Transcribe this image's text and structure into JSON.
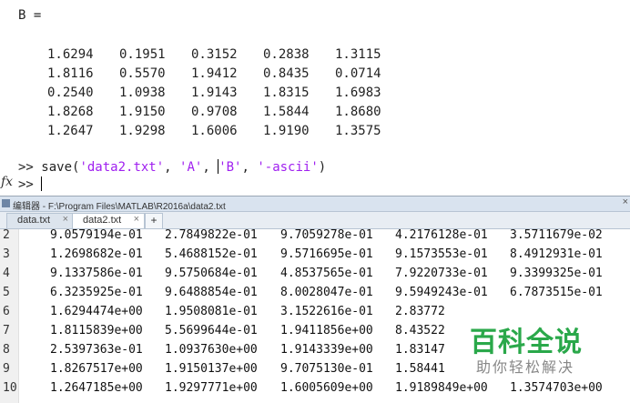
{
  "command_window": {
    "var_assign": "B =",
    "matrix": [
      [
        "1.6294",
        "0.1951",
        "0.3152",
        "0.2838",
        "1.3115"
      ],
      [
        "1.8116",
        "0.5570",
        "1.9412",
        "0.8435",
        "0.0714"
      ],
      [
        "0.2540",
        "1.0938",
        "1.9143",
        "1.8315",
        "1.6983"
      ],
      [
        "1.8268",
        "1.9150",
        "0.9708",
        "1.5844",
        "1.8680"
      ],
      [
        "1.2647",
        "1.9298",
        "1.6006",
        "1.9190",
        "1.3575"
      ]
    ],
    "prompt": ">>",
    "command_prefix": "save(",
    "arg1": "'data2.txt'",
    "sep1": ", ",
    "arg2": "'A'",
    "sep2": ", ",
    "arg3": "'B'",
    "sep3": ", ",
    "arg4": "'-ascii'",
    "command_suffix": ")",
    "fx_label": "fx"
  },
  "editor": {
    "title": "编辑器 - F:\\Program Files\\MATLAB\\R2016a\\data2.txt",
    "close_glyph": "×",
    "tabs": [
      {
        "label": "data.txt",
        "close": "×",
        "active": false
      },
      {
        "label": "data2.txt",
        "close": "×",
        "active": true
      }
    ],
    "add_tab": "+",
    "rows": [
      {
        "line": "2",
        "values": [
          "9.0579194e-01",
          "2.7849822e-01",
          "9.7059278e-01",
          "4.2176128e-01",
          "3.5711679e-02"
        ]
      },
      {
        "line": "3",
        "values": [
          "1.2698682e-01",
          "5.4688152e-01",
          "9.5716695e-01",
          "9.1573553e-01",
          "8.4912931e-01"
        ]
      },
      {
        "line": "4",
        "values": [
          "9.1337586e-01",
          "9.5750684e-01",
          "4.8537565e-01",
          "7.9220733e-01",
          "9.3399325e-01"
        ]
      },
      {
        "line": "5",
        "values": [
          "6.3235925e-01",
          "9.6488854e-01",
          "8.0028047e-01",
          "9.5949243e-01",
          "6.7873515e-01"
        ]
      },
      {
        "line": "6",
        "values": [
          "1.6294474e+00",
          "1.9508081e-01",
          "3.1522616e-01",
          "2.83772",
          ""
        ]
      },
      {
        "line": "7",
        "values": [
          "1.8115839e+00",
          "5.5699644e-01",
          "1.9411856e+00",
          "8.43522",
          ""
        ]
      },
      {
        "line": "8",
        "values": [
          "2.5397363e-01",
          "1.0937630e+00",
          "1.9143339e+00",
          "1.83147",
          ""
        ]
      },
      {
        "line": "9",
        "values": [
          "1.8267517e+00",
          "1.9150137e+00",
          "9.7075130e-01",
          "1.58441",
          ""
        ]
      },
      {
        "line": "10",
        "values": [
          "1.2647185e+00",
          "1.9297771e+00",
          "1.6005609e+00",
          "1.9189849e+00",
          "1.3574703e+00"
        ]
      }
    ]
  },
  "watermark": {
    "title": "百科全说",
    "subtitle": "助你轻松解决"
  },
  "colors": {
    "string_literal": "#a020f0",
    "watermark_green": "#2aa84a",
    "title_bar": "#d9e3ef"
  }
}
